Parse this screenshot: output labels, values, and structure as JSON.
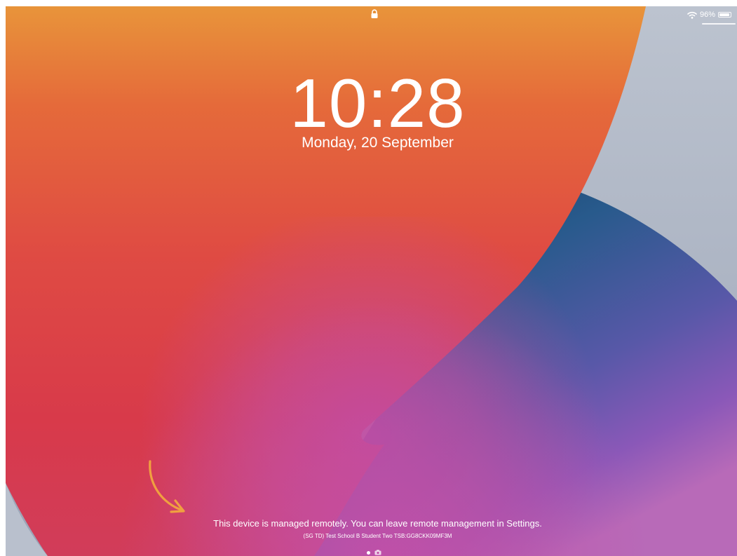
{
  "status_bar": {
    "battery_percent": "96%",
    "lock_icon": "lock-icon",
    "wifi_icon": "wifi-icon",
    "battery_icon": "battery-icon"
  },
  "lock_screen": {
    "time": "10:28",
    "date": "Monday, 20 September"
  },
  "management_notice": {
    "message": "This device is managed remotely. You can leave remote management in Settings.",
    "device_info": "(SG TD) Test School B Student Two TSB:GG8CKK09MF3M"
  },
  "page_indicator": {
    "current_page_icon": "dot",
    "camera_icon": "camera-icon"
  },
  "annotation": {
    "arrow_icon": "arrow-annotation-icon",
    "arrow_color": "#f0a040"
  },
  "colors": {
    "orange": "#e8943a",
    "red": "#d8394a",
    "navy": "#1f4f78",
    "purple": "#8a58b8",
    "magenta": "#c04ea8",
    "gray_blue": "#aeb6c5"
  }
}
